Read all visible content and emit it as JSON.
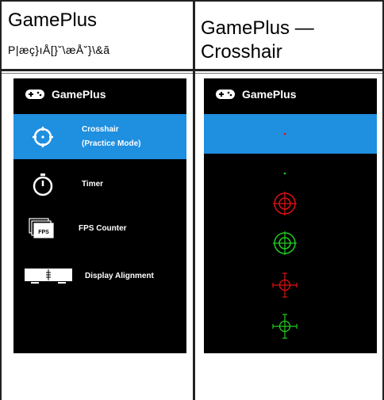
{
  "left": {
    "title": "GamePlus",
    "subtitle": "P|æç}ıÅ[}˘\\æÅ˘}\\&ã"
  },
  "right": {
    "title_line1": "GamePlus —",
    "title_line2": "Crosshair"
  },
  "menu": {
    "header": "GamePlus",
    "items": [
      {
        "label": "Crosshair\n(Practice Mode)",
        "line1": "Crosshair",
        "line2": "(Practice Mode)",
        "icon": "crosshair-icon",
        "selected": true
      },
      {
        "label": "Timer",
        "icon": "timer-icon",
        "selected": false
      },
      {
        "label": "FPS Counter",
        "icon": "fps-counter-icon",
        "fps_text": "FPS",
        "selected": false
      },
      {
        "label": "Display Alignment",
        "icon": "display-alignment-icon",
        "selected": false
      }
    ]
  },
  "crosshair": {
    "header": "GamePlus",
    "options": [
      {
        "name": "red-dot",
        "color": "#e01010"
      },
      {
        "name": "green-dot",
        "color": "#22cc22"
      },
      {
        "name": "red-ring",
        "color": "#e01010"
      },
      {
        "name": "green-ring",
        "color": "#22cc22"
      },
      {
        "name": "red-cross",
        "color": "#e01010"
      },
      {
        "name": "green-cross",
        "color": "#22cc22"
      }
    ]
  },
  "colors": {
    "accent": "#1f8fe0",
    "panel_bg": "#000000"
  }
}
